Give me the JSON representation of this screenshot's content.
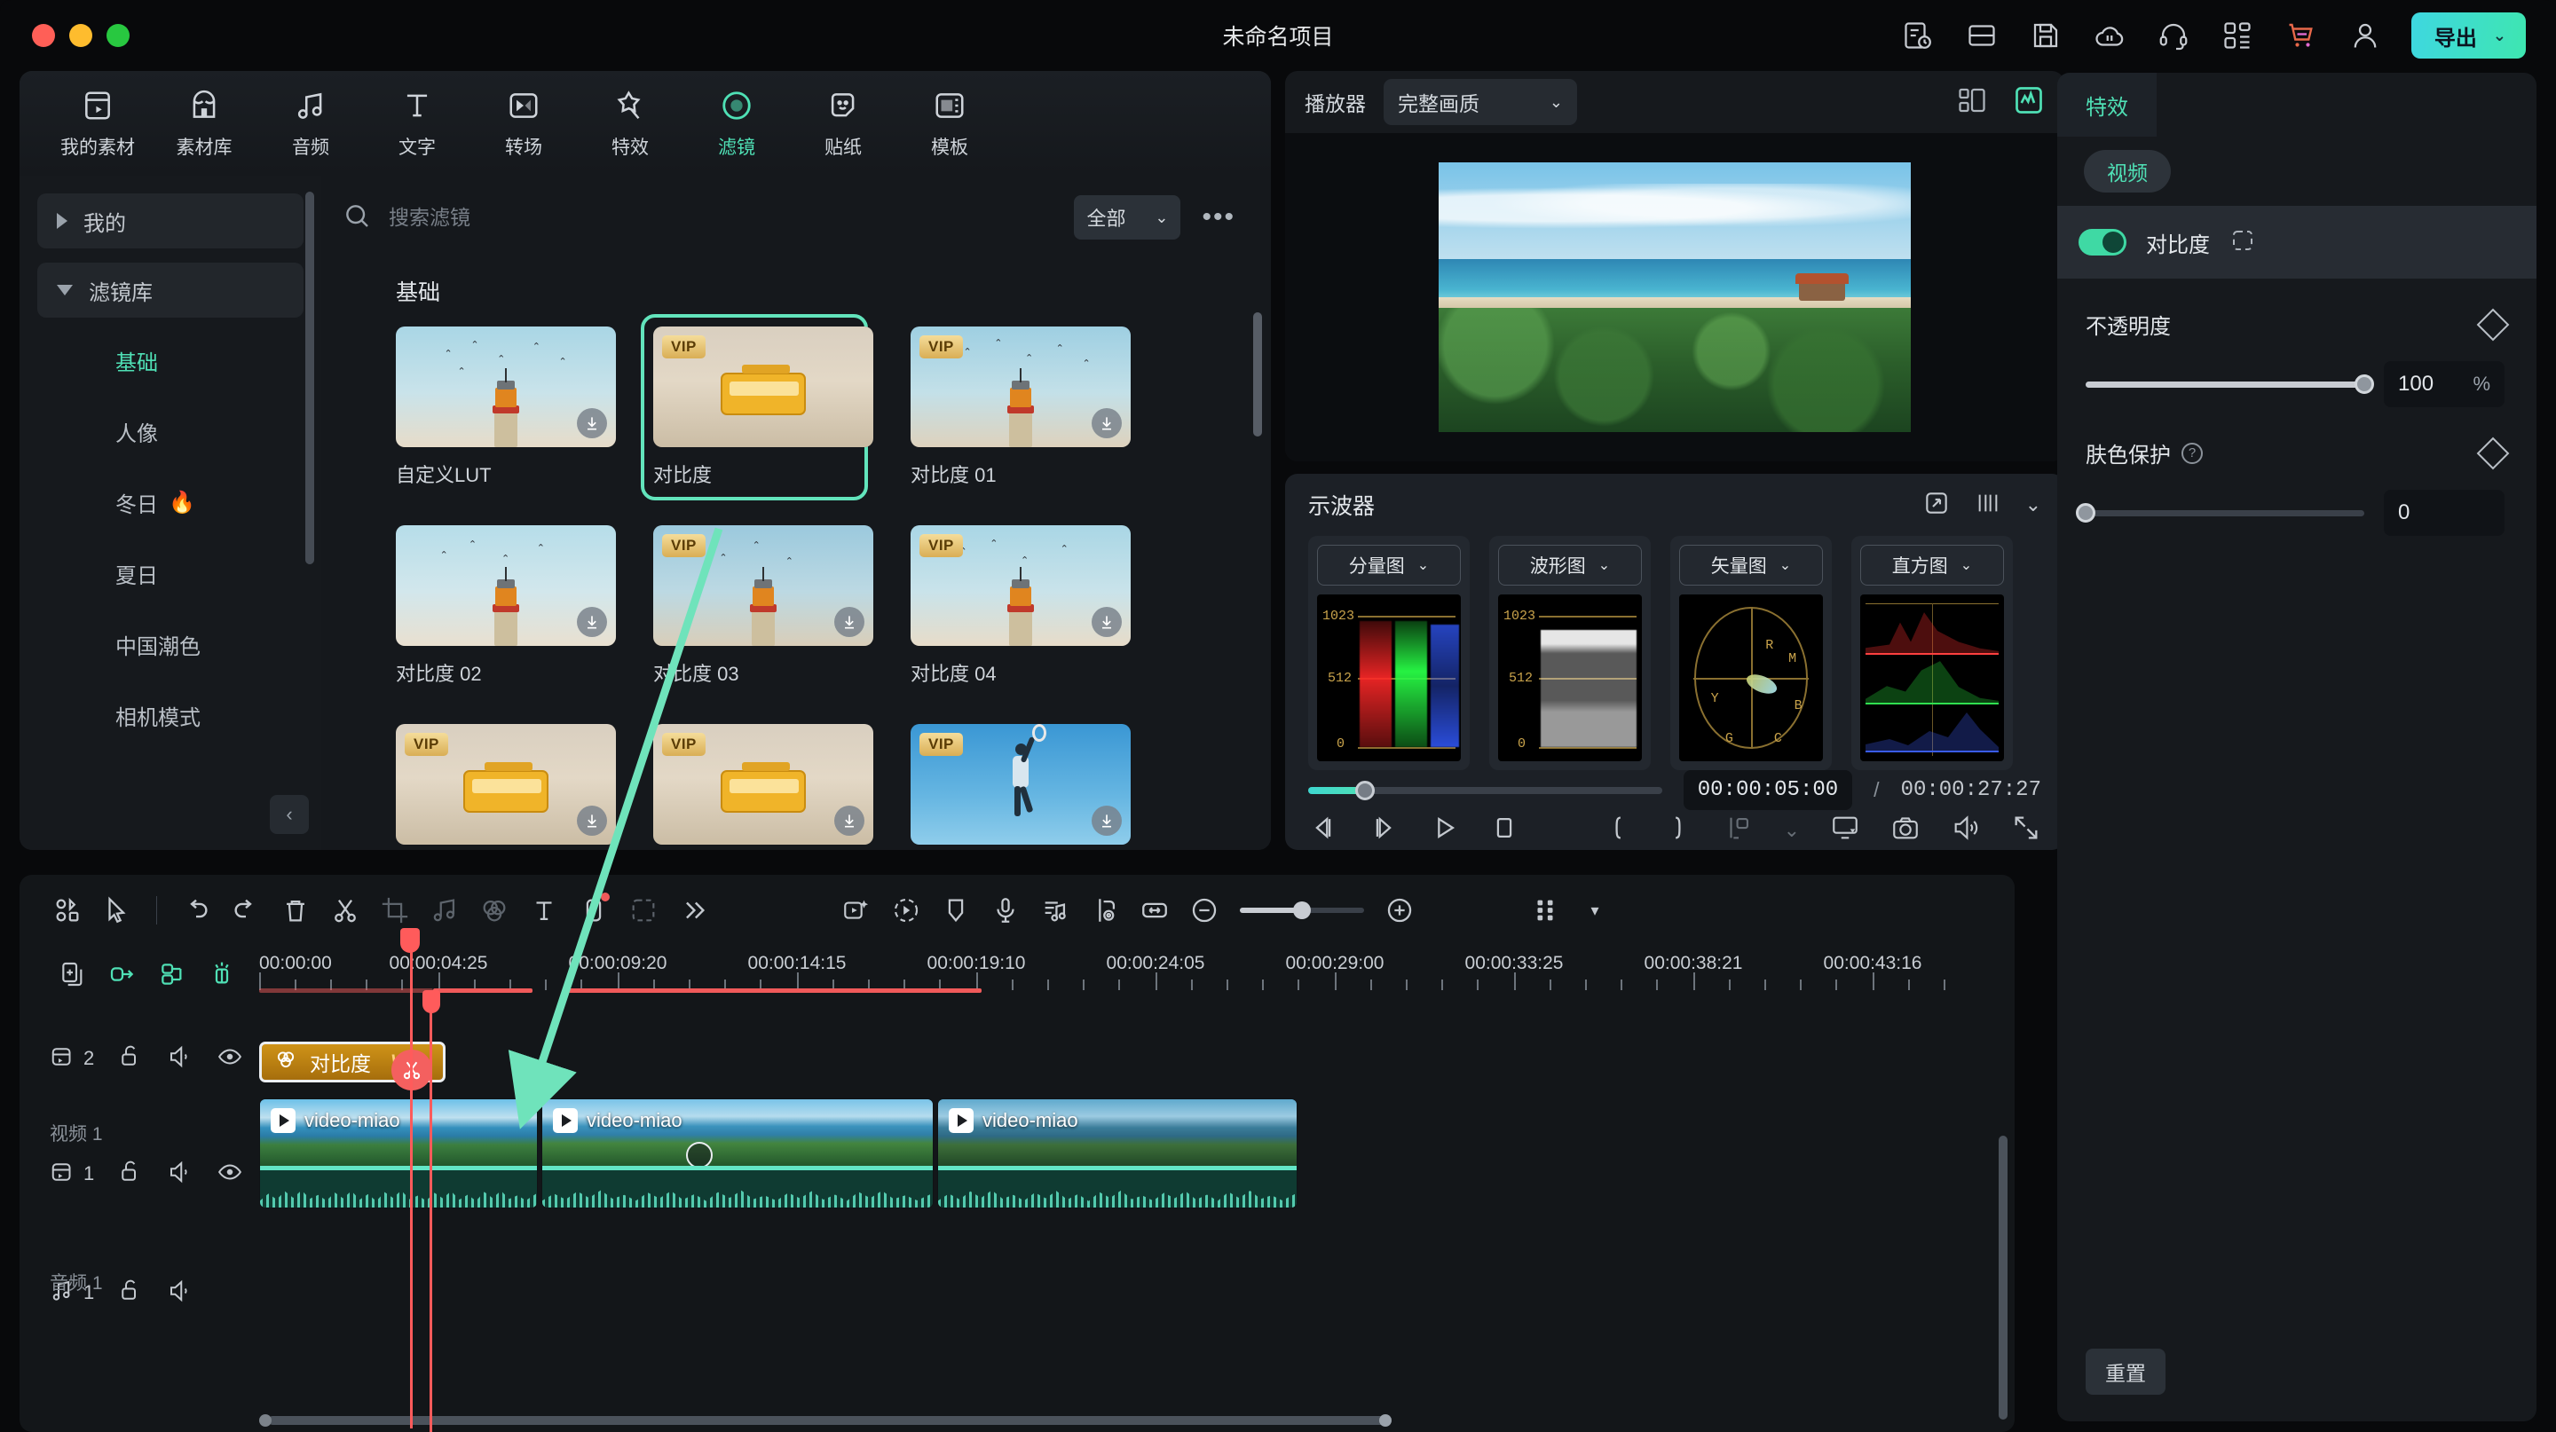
{
  "titlebar": {
    "project_title": "未命名项目",
    "export_label": "导出",
    "icons": [
      "task-list-icon",
      "layout-icon",
      "save-icon",
      "cloud-backup-icon",
      "headset-support-icon",
      "apps-grid-icon",
      "cart-icon",
      "account-icon"
    ]
  },
  "nav_tabs": [
    {
      "label": "我的素材",
      "icon": "media-icon",
      "active": false
    },
    {
      "label": "素材库",
      "icon": "stock-library-icon",
      "active": false
    },
    {
      "label": "音频",
      "icon": "audio-icon",
      "active": false
    },
    {
      "label": "文字",
      "icon": "text-icon",
      "active": false
    },
    {
      "label": "转场",
      "icon": "transition-icon",
      "active": false
    },
    {
      "label": "特效",
      "icon": "effects-icon",
      "active": false
    },
    {
      "label": "滤镜",
      "icon": "filter-icon",
      "active": true
    },
    {
      "label": "贴纸",
      "icon": "sticker-icon",
      "active": false
    },
    {
      "label": "模板",
      "icon": "template-icon",
      "active": false
    }
  ],
  "categories": {
    "groups": [
      {
        "label": "我的",
        "expanded": false
      },
      {
        "label": "滤镜库",
        "expanded": true
      }
    ],
    "items": [
      {
        "label": "基础",
        "active": true,
        "badge": ""
      },
      {
        "label": "人像",
        "active": false,
        "badge": ""
      },
      {
        "label": "冬日",
        "active": false,
        "badge": "🔥"
      },
      {
        "label": "夏日",
        "active": false,
        "badge": ""
      },
      {
        "label": "中国潮色",
        "active": false,
        "badge": ""
      },
      {
        "label": "相机模式",
        "active": false,
        "badge": ""
      }
    ]
  },
  "search": {
    "placeholder": "搜索滤镜",
    "filter_label": "全部",
    "more_label": "•••"
  },
  "filter_grid": {
    "section_title": "基础",
    "cards": [
      {
        "label": "自定义LUT",
        "vip": false,
        "download": true,
        "art": "lighthouse",
        "selected": false
      },
      {
        "label": "对比度",
        "vip": true,
        "download": false,
        "art": "bus",
        "selected": true
      },
      {
        "label": "对比度 01",
        "vip": true,
        "download": true,
        "art": "lighthouse",
        "selected": false
      },
      {
        "label": "对比度 02",
        "vip": false,
        "download": true,
        "art": "lighthouse",
        "selected": false
      },
      {
        "label": "对比度 03",
        "vip": true,
        "download": true,
        "art": "lighthouse",
        "selected": false
      },
      {
        "label": "对比度 04",
        "vip": true,
        "download": true,
        "art": "lighthouse",
        "selected": false
      },
      {
        "label": "",
        "vip": true,
        "download": true,
        "art": "bus",
        "selected": false
      },
      {
        "label": "",
        "vip": true,
        "download": true,
        "art": "bus",
        "selected": false
      },
      {
        "label": "",
        "vip": true,
        "download": true,
        "art": "sport",
        "selected": false
      }
    ]
  },
  "player": {
    "label": "播放器",
    "quality": "完整画质",
    "current_time": "00:00:05:00",
    "separator": "/",
    "total_time": "00:00:27:27",
    "progress_percent": 16,
    "right_icons": [
      "grid-view-icon",
      "scope-view-icon"
    ],
    "controls": [
      "prev-frame-icon",
      "next-frame-icon",
      "play-icon",
      "stop-icon",
      "mark-in-icon",
      "mark-out-icon",
      "snapshot-marker-icon",
      "chevron-down-icon",
      "cast-icon",
      "camera-icon",
      "volume-icon",
      "fullscreen-icon"
    ]
  },
  "scope": {
    "title": "示波器",
    "panels": [
      {
        "label": "分量图",
        "type": "parade",
        "axis_top": "1023",
        "axis_mid": "512",
        "axis_bottom": "0"
      },
      {
        "label": "波形图",
        "type": "waveform",
        "axis_top": "1023",
        "axis_mid": "512",
        "axis_bottom": "0"
      },
      {
        "label": "矢量图",
        "type": "vectorscope",
        "markers": [
          "R",
          "M",
          "B",
          "C",
          "G",
          "Y"
        ]
      },
      {
        "label": "直方图",
        "type": "histogram",
        "channels": [
          "R",
          "G",
          "B"
        ]
      }
    ]
  },
  "properties": {
    "tab": "特效",
    "chip": "视频",
    "effect_name": "对比度",
    "effect_enabled": true,
    "rows": [
      {
        "label": "不透明度",
        "value": "100",
        "unit": "%",
        "percent": 100,
        "has_help": false
      },
      {
        "label": "肤色保护",
        "value": "0",
        "unit": "",
        "percent": 0,
        "has_help": true
      }
    ],
    "reset_label": "重置"
  },
  "timeline_toolbar": {
    "left_icons": [
      "multi-select-icon",
      "cursor-icon",
      "undo-icon",
      "redo-icon",
      "delete-icon",
      "split-icon",
      "crop-icon",
      "audio-detach-icon",
      "color-icon",
      "text-icon",
      "mask-icon",
      "keying-icon",
      "more-icon"
    ],
    "right_icons": [
      "auto-reframe-icon",
      "speed-icon",
      "marker-icon",
      "voiceover-icon",
      "beat-detect-icon",
      "audio-sync-icon",
      "fit-timeline-icon",
      "zoom-out-icon",
      "zoom-in-icon",
      "track-view-icon",
      "dropdown-icon"
    ],
    "zoom_percent": 50
  },
  "timeline": {
    "track_tool_icons": [
      "add-track-icon",
      "link-icon",
      "group-icon",
      "marker-flash-icon"
    ],
    "ruler_ticks": [
      "00:00:00",
      "00:00:04:25",
      "00:00:09:20",
      "00:00:14:15",
      "00:00:19:10",
      "00:00:24:05",
      "00:00:29:00",
      "00:00:33:25",
      "00:00:38:21",
      "00:00:43:16"
    ],
    "tracks": [
      {
        "type": "video",
        "count": "2",
        "name": "",
        "icons": [
          "video-track-icon",
          "lock-icon",
          "mute-icon",
          "eye-icon"
        ]
      },
      {
        "type": "video",
        "count": "1",
        "name": "视频 1",
        "icons": [
          "video-track-icon",
          "lock-icon",
          "mute-icon",
          "eye-icon"
        ]
      },
      {
        "type": "audio",
        "count": "1",
        "name": "音频 1",
        "icons": [
          "audio-track-icon",
          "lock-icon",
          "mute-icon"
        ]
      }
    ],
    "effect_clip": {
      "label": "对比度",
      "vip_label": "VIP"
    },
    "video_clips": [
      {
        "label": "video-miao"
      },
      {
        "label": "video-miao"
      },
      {
        "label": "video-miao"
      }
    ]
  }
}
